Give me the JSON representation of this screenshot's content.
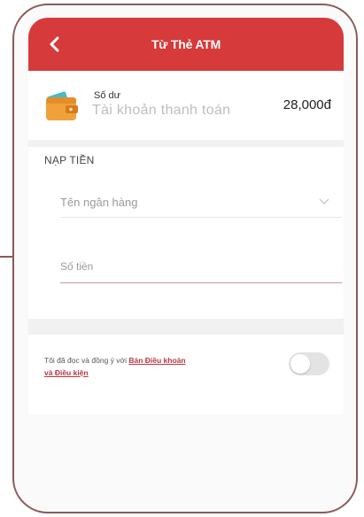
{
  "header": {
    "title": "Từ Thẻ ATM",
    "back_icon": "chevron-left-icon"
  },
  "balance": {
    "label": "Số dư",
    "account_type": "Tài khoản thanh toán",
    "amount": "28,000đ",
    "icon": "wallet-icon"
  },
  "section": {
    "title": "NẠP TIỀN"
  },
  "form": {
    "bank_placeholder": "Tên ngân hàng",
    "amount_placeholder": "Số tiền"
  },
  "terms": {
    "prefix": "Tôi đã đọc và đồng ý với ",
    "link1": "Bản Điều khoản",
    "link2": "và Điều kiện",
    "toggle_on": false
  },
  "colors": {
    "brand_red": "#d63a3a",
    "link_red": "#b5393f"
  }
}
